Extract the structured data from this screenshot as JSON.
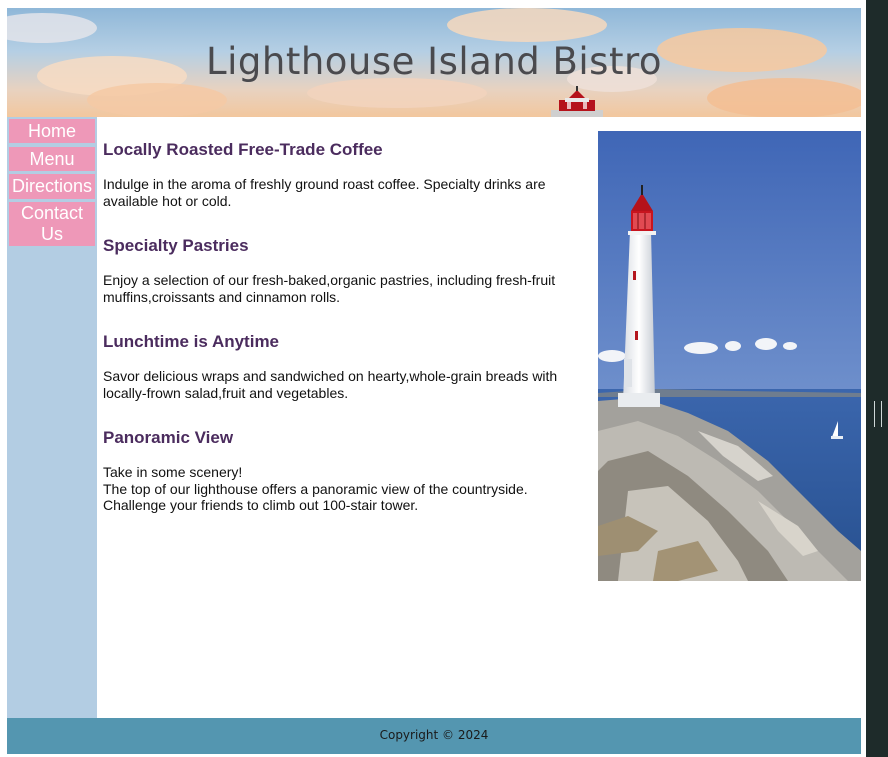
{
  "header": {
    "title": "Lighthouse Island Bistro"
  },
  "nav": {
    "items": [
      {
        "label": "Home"
      },
      {
        "label": "Menu"
      },
      {
        "label": "Directions"
      },
      {
        "label": "Contact Us"
      }
    ]
  },
  "content": {
    "sections": [
      {
        "heading": "Locally Roasted Free-Trade Coffee",
        "text": "Indulge in the aroma of freshly ground roast coffee. Specialty drinks are available hot or cold."
      },
      {
        "heading": "Specialty Pastries",
        "text": "Enjoy a selection of our fresh-baked,organic pastries, including fresh-fruit muffins,croissants and cinnamon rolls."
      },
      {
        "heading": "Lunchtime is Anytime",
        "text": "Savor delicious wraps and sandwiched on hearty,whole-grain breads with locally-frown salad,fruit and vegetables."
      },
      {
        "heading": "Panoramic View",
        "lines": [
          "Take in some scenery!",
          "The top of our lighthouse offers a panoramic view of the countryside.",
          "Challenge your friends to climb out 100-stair tower."
        ]
      }
    ]
  },
  "footer": {
    "copyright": "Copyright © 2024"
  },
  "colors": {
    "sidebar": "#b3cde3",
    "nav_button": "#ee98b8",
    "heading": "#4b2c5e",
    "footer": "#5496b0"
  },
  "images": {
    "header": "sky-with-clouds-banner",
    "photo": "white-lighthouse-on-rocky-coast"
  }
}
